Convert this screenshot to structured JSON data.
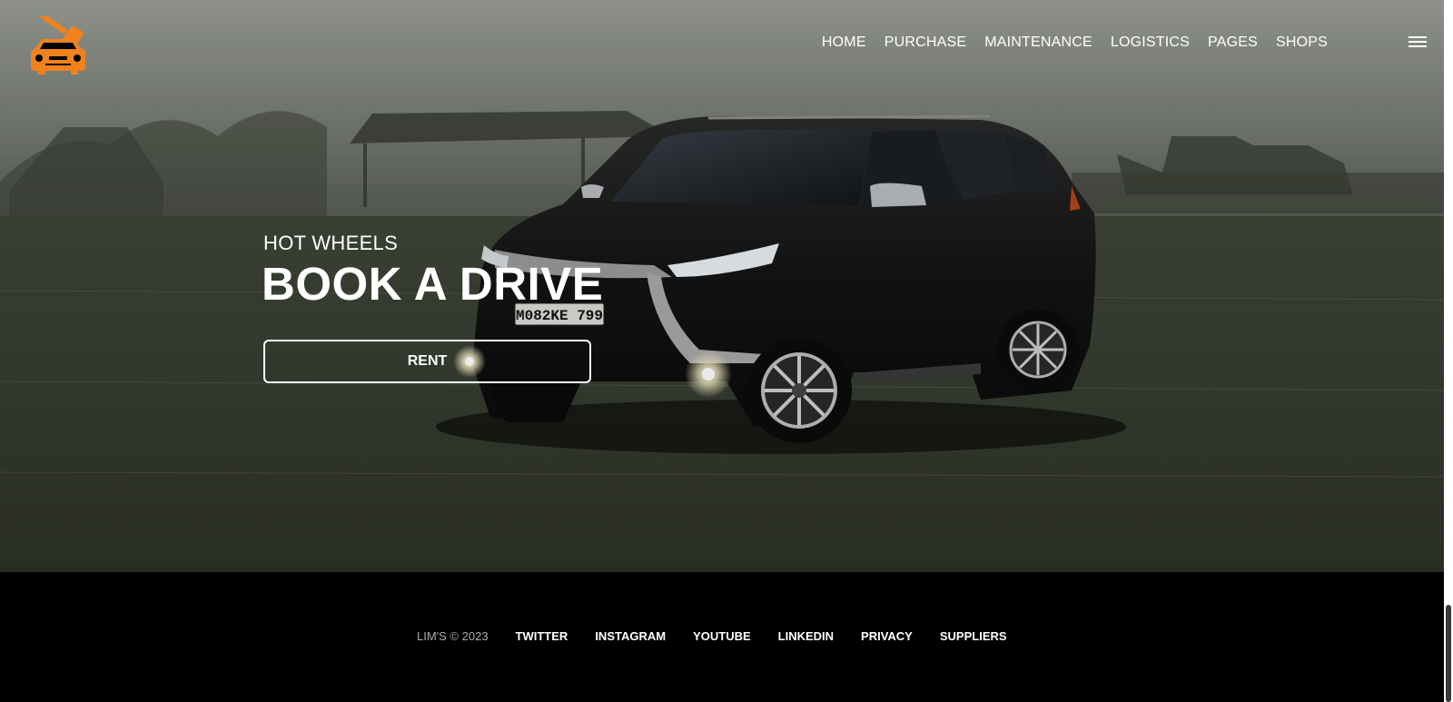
{
  "brand": {
    "logo_icon": "car-key-icon",
    "accent_color": "#f0821e"
  },
  "nav": {
    "items": [
      "HOME",
      "PURCHASE",
      "MAINTENANCE",
      "LOGISTICS",
      "PAGES",
      "SHOPS"
    ],
    "menu_icon": "hamburger-icon"
  },
  "hero": {
    "subtitle": "HOT WHEELS",
    "title": "BOOK A DRIVE",
    "cta_label": "RENT",
    "plate": "M082KE 799"
  },
  "footer": {
    "copyright": "LIM'S © 2023",
    "links": [
      "TWITTER",
      "INSTAGRAM",
      "YOUTUBE",
      "LINKEDIN",
      "PRIVACY",
      "SUPPLIERS"
    ]
  }
}
